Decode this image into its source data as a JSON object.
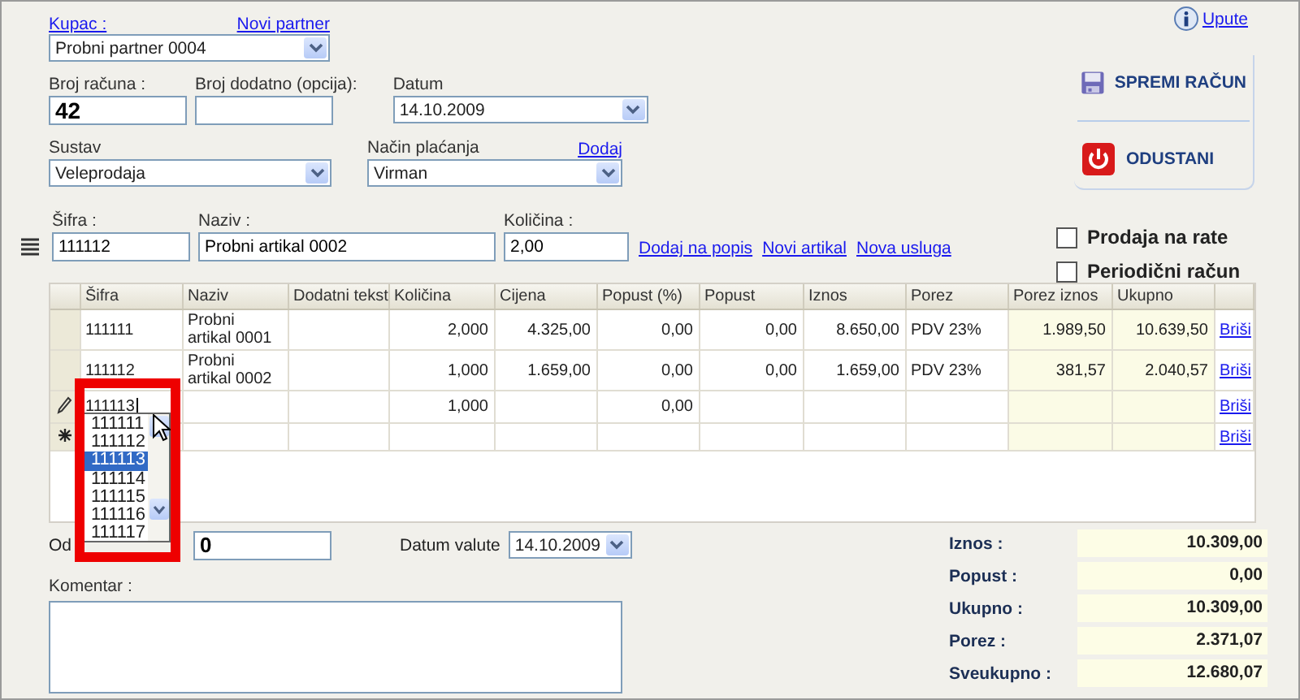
{
  "customer": {
    "label": "Kupac :",
    "link": "Novi partner",
    "value": "Probni partner 0004"
  },
  "help_link": "Upute",
  "invoice_number": {
    "label": "Broj računa :",
    "value": "42"
  },
  "extra_number": {
    "label": "Broj dodatno (opcija):"
  },
  "date": {
    "label": "Datum",
    "value": "14.10.2009"
  },
  "system": {
    "label": "Sustav",
    "value": "Veleprodaja"
  },
  "payment": {
    "label": "Način plaćanja",
    "link": "Dodaj",
    "value": "Virman"
  },
  "actions": [
    {
      "kind": "save",
      "label": "SPREMI RAČUN"
    },
    {
      "kind": "cancel",
      "label": "ODUSTANI"
    }
  ],
  "options": [
    {
      "label": "Prodaja na rate",
      "checked": false
    },
    {
      "label": "Periodični račun",
      "checked": false
    }
  ],
  "item_entry": {
    "fields": [
      {
        "label": "Šifra :",
        "value": "111112"
      },
      {
        "label": "Naziv :",
        "value": "Probni artikal 0002"
      },
      {
        "label": "Količina :",
        "value": "2,00"
      }
    ],
    "links": [
      "Dodaj na popis",
      "Novi artikal",
      "Nova usluga"
    ]
  },
  "table": {
    "columns": [
      {
        "label": "Šifra",
        "kind": "text"
      },
      {
        "label": "Naziv",
        "kind": "text"
      },
      {
        "label": "Dodatni tekst",
        "kind": "text"
      },
      {
        "label": "Količina",
        "kind": "number"
      },
      {
        "label": "Cijena",
        "kind": "number"
      },
      {
        "label": "Popust (%)",
        "kind": "number"
      },
      {
        "label": "Popust",
        "kind": "number"
      },
      {
        "label": "Iznos",
        "kind": "number"
      },
      {
        "label": "Porez",
        "kind": "text"
      },
      {
        "label": "Porez iznos",
        "kind": "total"
      },
      {
        "label": "Ukupno",
        "kind": "total"
      }
    ],
    "rows": [
      {
        "kind": "normal",
        "cells": [
          "111111",
          "Probni artikal 0001",
          null,
          "2,000",
          "4.325,00",
          "0,00",
          "0,00",
          "8.650,00",
          "PDV 23%",
          "1.989,50",
          "10.639,50"
        ],
        "action": "Briši"
      },
      {
        "kind": "normal",
        "cells": [
          "111112",
          "Probni artikal 0002",
          null,
          "1,000",
          "1.659,00",
          "0,00",
          "0,00",
          "1.659,00",
          "PDV 23%",
          "381,57",
          "2.040,57"
        ],
        "action": "Briši"
      },
      {
        "kind": "editing",
        "cells": [
          "111113",
          null,
          null,
          "1,000",
          null,
          "0,00",
          null,
          null,
          null,
          null,
          null
        ],
        "action": "Briši"
      },
      {
        "kind": "new",
        "cells": [
          null,
          null,
          null,
          null,
          null,
          null,
          null,
          null,
          null,
          null,
          null
        ],
        "action": "Briši"
      }
    ]
  },
  "autocomplete": {
    "items": [
      {
        "label": "111111",
        "selected": false
      },
      {
        "label": "111112",
        "selected": false
      },
      {
        "label": "111113",
        "selected": true
      },
      {
        "label": "111114",
        "selected": false
      },
      {
        "label": "111115",
        "selected": false
      },
      {
        "label": "111116",
        "selected": false
      },
      {
        "label": "111117",
        "selected": false
      }
    ]
  },
  "discount_days": {
    "label": "Od",
    "value": "0"
  },
  "value_date": {
    "label": "Datum valute",
    "value": "14.10.2009"
  },
  "comment": {
    "label": "Komentar :"
  },
  "totals": [
    {
      "label": "Iznos :",
      "value": "10.309,00"
    },
    {
      "label": "Popust :",
      "value": "0,00"
    },
    {
      "label": "Ukupno :",
      "value": "10.309,00"
    },
    {
      "label": "Porez :",
      "value": "2.371,07"
    },
    {
      "label": "Sveukupno :",
      "value": "12.680,07"
    }
  ]
}
